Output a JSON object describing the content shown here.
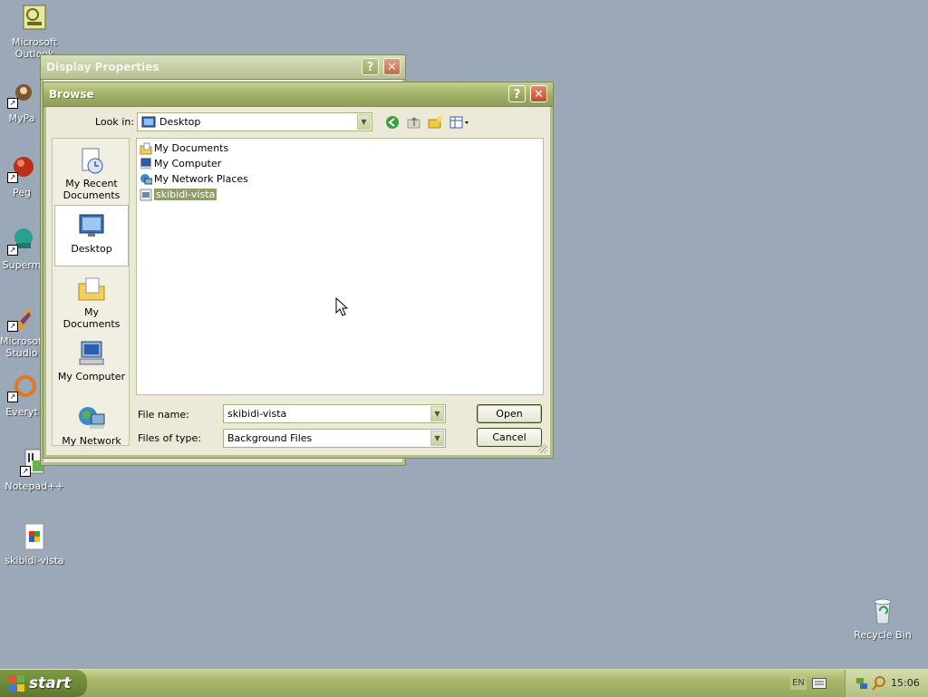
{
  "desktop": {
    "icons": [
      {
        "label": "Microsoft Outlook"
      },
      {
        "label": "MyPa"
      },
      {
        "label": "Peg"
      },
      {
        "label": "Superm"
      },
      {
        "label": "Microsoft Studio"
      },
      {
        "label": "Everyt"
      },
      {
        "label": "Notepad++"
      },
      {
        "label": "skibidi-vista"
      },
      {
        "label": "Recycle Bin"
      }
    ]
  },
  "display_properties": {
    "title": "Display Properties",
    "help": "?",
    "close": "✕"
  },
  "browse": {
    "title": "Browse",
    "help": "?",
    "close": "✕",
    "look_in_label": "Look in:",
    "look_in_value": "Desktop",
    "places": [
      {
        "label": "My Recent Documents"
      },
      {
        "label": "Desktop"
      },
      {
        "label": "My Documents"
      },
      {
        "label": "My Computer"
      },
      {
        "label": "My Network"
      }
    ],
    "files": [
      {
        "name": "My Documents"
      },
      {
        "name": "My Computer"
      },
      {
        "name": "My Network Places"
      },
      {
        "name": "skibidi-vista"
      }
    ],
    "file_name_label": "File name:",
    "file_name_value": "skibidi-vista",
    "files_of_type_label": "Files of type:",
    "files_of_type_value": "Background Files",
    "open_label": "Open",
    "cancel_label": "Cancel"
  },
  "taskbar": {
    "start_label": "start",
    "language": "EN",
    "clock": "15:06"
  },
  "colors": {
    "accent": "#a3b26a",
    "desktop": "#9aa8b8",
    "selection": "#8f9d6a"
  }
}
